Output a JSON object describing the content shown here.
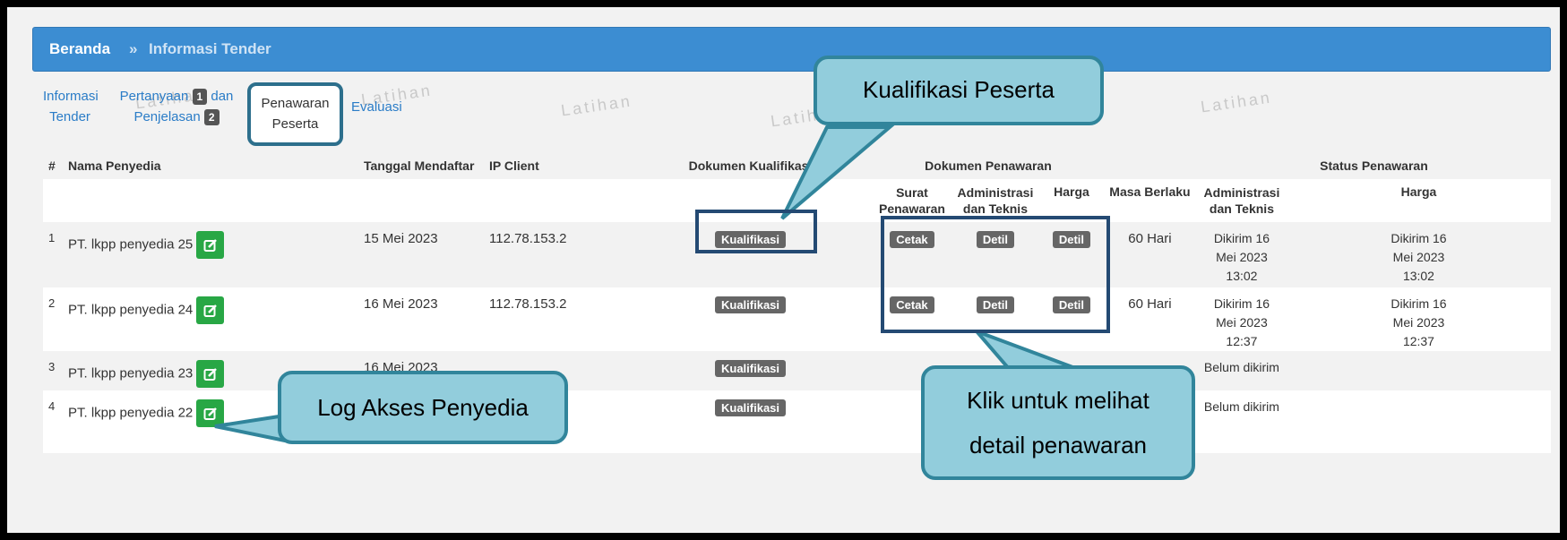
{
  "breadcrumb": {
    "home": "Beranda",
    "separator": "»",
    "current": "Informasi Tender"
  },
  "tabs": {
    "informasi": [
      "Informasi",
      "Tender"
    ],
    "pertanyaan": {
      "line1": "Pertanyaan",
      "badge1": "1",
      "line1b": "dan",
      "line2": "Penjelasan",
      "badge2": "2"
    },
    "penawaran": [
      "Penawaran",
      "Peserta"
    ],
    "evaluasi": "Evaluasi"
  },
  "watermark": "Latihan",
  "table": {
    "headers": {
      "no": "#",
      "nama": "Nama Penyedia",
      "tanggal": "Tanggal Mendaftar",
      "ip": "IP Client",
      "dok_kualifikasi": "Dokumen Kualifikasi",
      "dok_penawaran": "Dokumen Penawaran",
      "status": "Status Penawaran",
      "surat": [
        "Surat",
        "Penawaran"
      ],
      "admin": [
        "Administrasi",
        "dan Teknis"
      ],
      "harga": "Harga",
      "masa": "Masa Berlaku",
      "status_admin": [
        "Administrasi",
        "dan Teknis"
      ],
      "status_harga": "Harga"
    },
    "rows": [
      {
        "no": "1",
        "nama": "PT. lkpp penyedia 25",
        "tanggal": "15 Mei 2023",
        "ip": "112.78.153.2",
        "kualifikasi": "Kualifikasi",
        "surat": "Cetak",
        "admin": "Detil",
        "harga": "Detil",
        "masa": "60 Hari",
        "status_admin": [
          "Dikirim 16",
          "Mei 2023",
          "13:02"
        ],
        "status_harga": [
          "Dikirim 16",
          "Mei 2023",
          "13:02"
        ]
      },
      {
        "no": "2",
        "nama": "PT. lkpp penyedia 24",
        "tanggal": "16 Mei 2023",
        "ip": "112.78.153.2",
        "kualifikasi": "Kualifikasi",
        "surat": "Cetak",
        "admin": "Detil",
        "harga": "Detil",
        "masa": "60 Hari",
        "status_admin": [
          "Dikirim 16",
          "Mei 2023",
          "12:37"
        ],
        "status_harga": [
          "Dikirim 16",
          "Mei 2023",
          "12:37"
        ]
      },
      {
        "no": "3",
        "nama": "PT. lkpp penyedia 23",
        "tanggal": "16 Mei 2023",
        "ip": "",
        "kualifikasi": "Kualifikasi",
        "status_admin_text": "Belum dikirim"
      },
      {
        "no": "4",
        "nama": "PT. lkpp penyedia 22",
        "tanggal": "",
        "ip": "",
        "kualifikasi": "Kualifikasi",
        "status_admin_text": "Belum dikirim"
      }
    ]
  },
  "callouts": {
    "kualifikasi": "Kualifikasi Peserta",
    "log_akses": "Log Akses Penyedia",
    "klik": [
      "Klik untuk melihat",
      "detail penawaran"
    ]
  },
  "colors": {
    "header_bar": "#3c8dd2",
    "callout_fill": "#92cddc",
    "callout_border": "#31859b",
    "edit_button": "#28a745",
    "label_badge": "#666666"
  },
  "icons": {
    "edit": "edit-icon"
  }
}
